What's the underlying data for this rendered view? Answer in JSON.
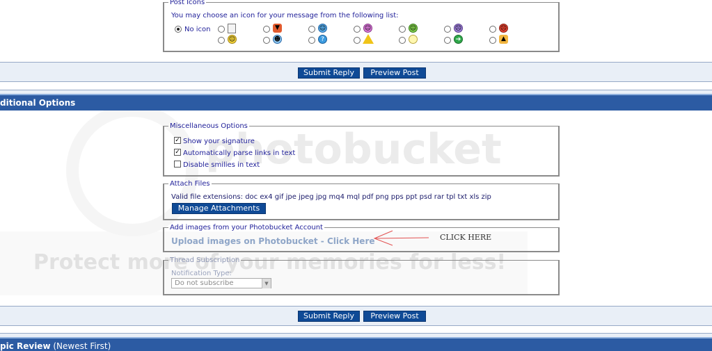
{
  "post_icons": {
    "legend": "Post Icons",
    "prompt": "You may choose an icon for your message from the following list:",
    "no_icon_label": "No icon",
    "icons": [
      "document-icon",
      "thumbs-down-icon",
      "smile-icon",
      "grin-icon",
      "teeth-icon",
      "frown-icon",
      "angry-icon",
      "happy-icon",
      "cool-icon",
      "question-icon",
      "warning-icon",
      "lightbulb-icon",
      "arrow-icon",
      "thumbs-up-icon"
    ]
  },
  "buttons": {
    "submit": "Submit Reply",
    "preview": "Preview Post"
  },
  "additional_header": "ditional Options",
  "misc": {
    "legend": "Miscellaneous Options",
    "opts": [
      {
        "label": "Show your signature",
        "checked": true
      },
      {
        "label": "Automatically parse links in text",
        "checked": true
      },
      {
        "label": "Disable smilies in text",
        "checked": false
      }
    ]
  },
  "attach": {
    "legend": "Attach Files",
    "extensions": "Valid file extensions: doc ex4 gif jpe jpeg jpg mq4 mql pdf png pps ppt psd rar tpl txt xls zip",
    "manage": "Manage Attachments"
  },
  "photobucket": {
    "legend": "Add images from your Photobucket Account",
    "link": "Upload images on Photobucket - Click Here",
    "annotation": "CLICK HERE"
  },
  "subscription": {
    "legend": "Thread Subscription",
    "type_label": "Notification Type:",
    "selected": "Do not subscribe"
  },
  "review": {
    "bold": "pic Review",
    "rest": " (Newest First)"
  },
  "watermark": {
    "logo": "photobucket",
    "tagline": "Protect more of your memories for less!"
  }
}
